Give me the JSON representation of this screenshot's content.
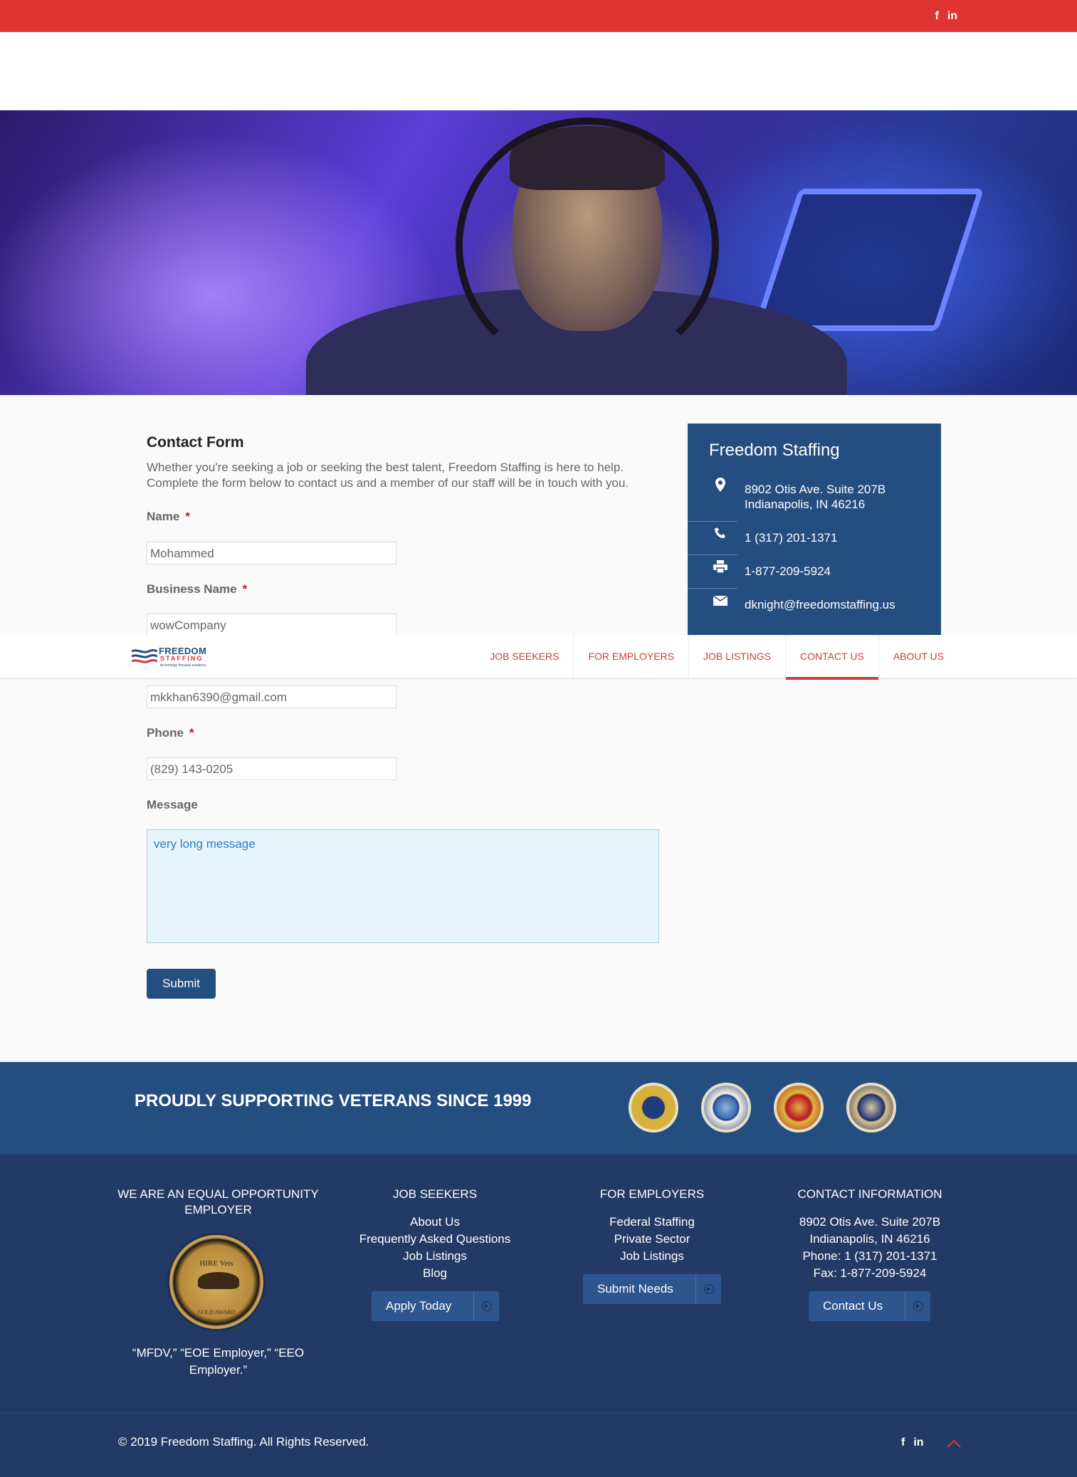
{
  "topbar": {
    "social": [
      "f",
      "in"
    ]
  },
  "contact_form": {
    "title": "Contact Form",
    "intro": "Whether you're seeking a job or seeking the best talent, Freedom Staffing is here to help. Complete the form below to contact us and a member of our staff will be in touch with you.",
    "fields": {
      "name": {
        "label": "Name",
        "required": "*",
        "value": "Mohammed"
      },
      "business": {
        "label": "Business Name",
        "required": "*",
        "value": "wowCompany"
      },
      "email": {
        "value": "mkkhan6390@gmail.com"
      },
      "phone": {
        "label": "Phone",
        "required": "*",
        "value": "(829) 143-0205"
      },
      "message": {
        "label": "Message",
        "value": "very long message"
      }
    },
    "submit_label": "Submit"
  },
  "info": {
    "title": "Freedom Staffing",
    "address_line1": "8902 Otis Ave. Suite 207B",
    "address_line2": "Indianapolis, IN 46216",
    "phone": "1 (317) 201-1371",
    "fax": "1-877-209-5924",
    "email": "dknight@freedomstaffing.us",
    "icons": [
      "map-pin-icon",
      "phone-icon",
      "printer-icon",
      "envelope-icon"
    ]
  },
  "nav": {
    "logo_name": "FREEDOM",
    "logo_sub": "STAFFING",
    "logo_tag": "technology focused solutions",
    "items": [
      "JOB SEEKERS",
      "FOR EMPLOYERS",
      "JOB LISTINGS",
      "CONTACT US",
      "ABOUT US"
    ],
    "active": "CONTACT US"
  },
  "vets": {
    "title": "PROUDLY SUPPORTING VETERANS SINCE 1999",
    "seals": [
      "army-seal",
      "air-force-seal",
      "marine-corps-seal",
      "navy-seal"
    ]
  },
  "footer": {
    "col1": {
      "title": "WE ARE AN EQUAL OPPORTUNITY EMPLOYER",
      "award_top": "HIRE Vets",
      "award_bottom": "GOLD AWARD",
      "note": "“MFDV,” “EOE Employer,” “EEO Employer.”"
    },
    "col2": {
      "title": "JOB SEEKERS",
      "links": [
        "About Us",
        "Frequently Asked Questions",
        "Job Listings",
        "Blog"
      ],
      "button": "Apply Today"
    },
    "col3": {
      "title": "FOR EMPLOYERS",
      "links": [
        "Federal Staffing",
        "Private Sector",
        "Job Listings"
      ],
      "button": "Submit Needs"
    },
    "col4": {
      "title": "CONTACT INFORMATION",
      "lines": [
        "8902 Otis Ave. Suite 207B",
        "Indianapolis, IN 46216",
        "Phone: 1 (317) 201-1371",
        "Fax: 1-877-209-5924"
      ],
      "button": "Contact Us"
    }
  },
  "bottom": {
    "copyright": "© 2019 Freedom Staffing. All Rights Reserved.",
    "social": [
      "f",
      "in"
    ]
  },
  "colors": {
    "red": "#e03434",
    "navy": "#244e80",
    "footer": "#243a66"
  }
}
